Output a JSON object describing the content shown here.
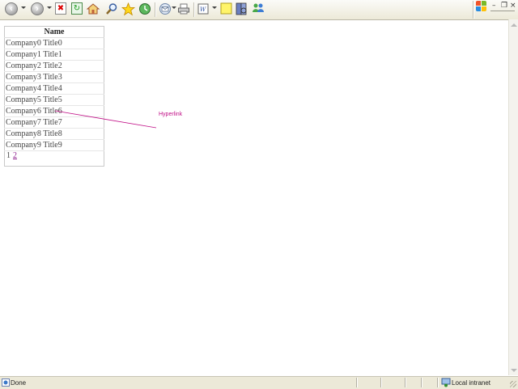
{
  "table": {
    "header": "Name",
    "rows": [
      "Company0 Title0",
      "Company1 Title1",
      "Company2 Title2",
      "Company3 Title3",
      "Company4 Title4",
      "Company5 Title5",
      "Company6 Title6",
      "Company7 Title7",
      "Company8 Title8",
      "Company9 Title9"
    ],
    "pager": {
      "page1": "1",
      "page2": "2"
    }
  },
  "annotation": {
    "label": "Hyperlink",
    "color": "#c00e86"
  },
  "statusbar": {
    "status": "Done",
    "zone": "Local intranet"
  },
  "toolbar_icons": [
    "back-icon",
    "forward-icon",
    "stop-icon",
    "refresh-icon",
    "home-icon",
    "search-icon",
    "favorites-icon",
    "history-icon",
    "mail-icon",
    "print-icon",
    "edit-icon",
    "notes-icon",
    "research-icon",
    "messenger-icon"
  ]
}
